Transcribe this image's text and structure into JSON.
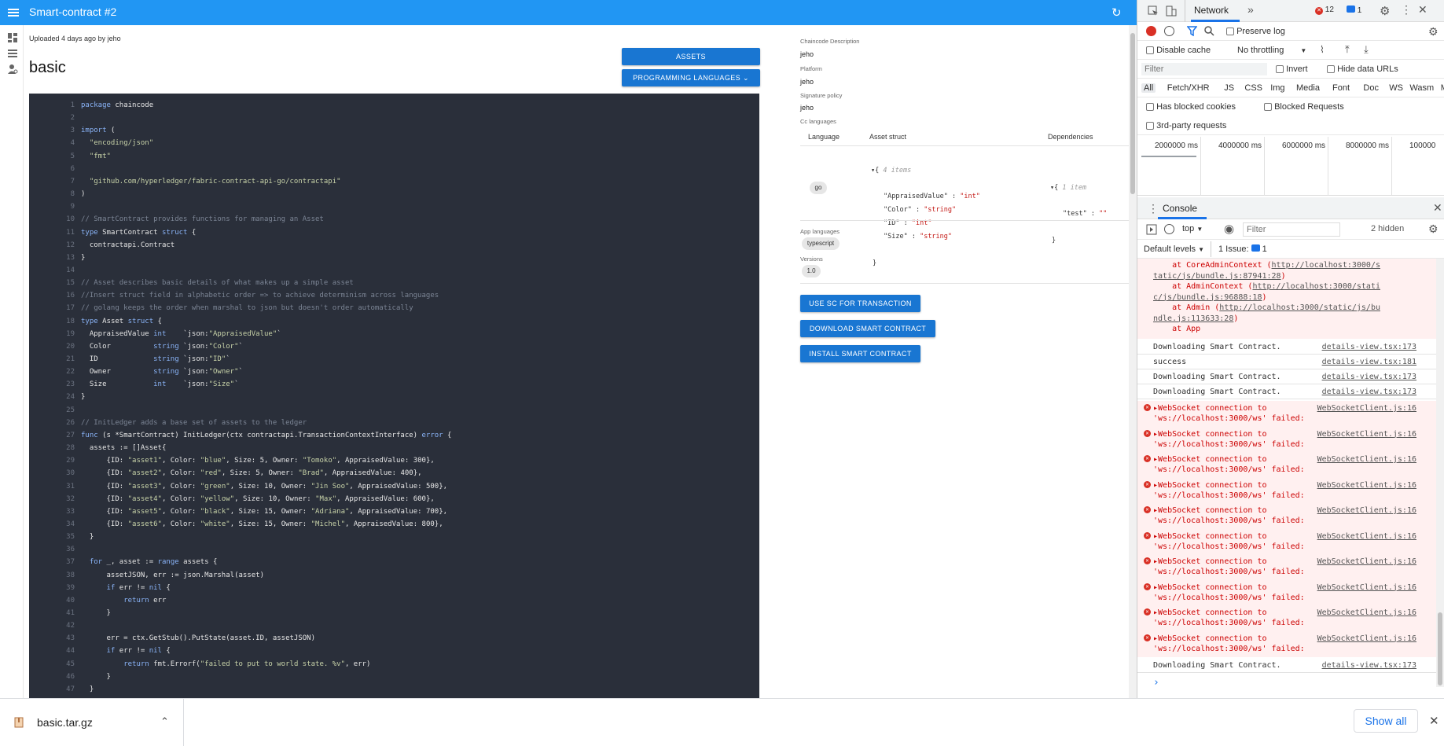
{
  "app": {
    "title": "Smart-contract #2",
    "uploaded": "Uploaded 4 days ago by jeho",
    "project_title": "basic",
    "assets_label": "ASSETS",
    "prog_lang_label": "PROGRAMMING LANGUAGES",
    "colors": {
      "appbar": "#2196f3",
      "button": "#1976d2",
      "code_bg": "#2a2f3a"
    }
  },
  "code": {
    "lines": [
      {
        "n": "1",
        "t": "package chaincode"
      },
      {
        "n": "2",
        "t": ""
      },
      {
        "n": "3",
        "t": "import ("
      },
      {
        "n": "4",
        "t": "  \"encoding/json\""
      },
      {
        "n": "5",
        "t": "  \"fmt\""
      },
      {
        "n": "6",
        "t": ""
      },
      {
        "n": "7",
        "t": "  \"github.com/hyperledger/fabric-contract-api-go/contractapi\""
      },
      {
        "n": "8",
        "t": ")"
      },
      {
        "n": "9",
        "t": ""
      },
      {
        "n": "10",
        "t": "// SmartContract provides functions for managing an Asset"
      },
      {
        "n": "11",
        "t": "type SmartContract struct {"
      },
      {
        "n": "12",
        "t": "  contractapi.Contract"
      },
      {
        "n": "13",
        "t": "}"
      },
      {
        "n": "14",
        "t": ""
      },
      {
        "n": "15",
        "t": "// Asset describes basic details of what makes up a simple asset"
      },
      {
        "n": "16",
        "t": "//Insert struct field in alphabetic order => to achieve determinism across languages"
      },
      {
        "n": "17",
        "t": "// golang keeps the order when marshal to json but doesn't order automatically"
      },
      {
        "n": "18",
        "t": "type Asset struct {"
      },
      {
        "n": "19",
        "t": "  AppraisedValue int    `json:\"AppraisedValue\"`"
      },
      {
        "n": "20",
        "t": "  Color          string `json:\"Color\"`"
      },
      {
        "n": "21",
        "t": "  ID             string `json:\"ID\"`"
      },
      {
        "n": "22",
        "t": "  Owner          string `json:\"Owner\"`"
      },
      {
        "n": "23",
        "t": "  Size           int    `json:\"Size\"`"
      },
      {
        "n": "24",
        "t": "}"
      },
      {
        "n": "25",
        "t": ""
      },
      {
        "n": "26",
        "t": "// InitLedger adds a base set of assets to the ledger"
      },
      {
        "n": "27",
        "t": "func (s *SmartContract) InitLedger(ctx contractapi.TransactionContextInterface) error {"
      },
      {
        "n": "28",
        "t": "  assets := []Asset{"
      },
      {
        "n": "29",
        "t": "      {ID: \"asset1\", Color: \"blue\", Size: 5, Owner: \"Tomoko\", AppraisedValue: 300},"
      },
      {
        "n": "30",
        "t": "      {ID: \"asset2\", Color: \"red\", Size: 5, Owner: \"Brad\", AppraisedValue: 400},"
      },
      {
        "n": "31",
        "t": "      {ID: \"asset3\", Color: \"green\", Size: 10, Owner: \"Jin Soo\", AppraisedValue: 500},"
      },
      {
        "n": "32",
        "t": "      {ID: \"asset4\", Color: \"yellow\", Size: 10, Owner: \"Max\", AppraisedValue: 600},"
      },
      {
        "n": "33",
        "t": "      {ID: \"asset5\", Color: \"black\", Size: 15, Owner: \"Adriana\", AppraisedValue: 700},"
      },
      {
        "n": "34",
        "t": "      {ID: \"asset6\", Color: \"white\", Size: 15, Owner: \"Michel\", AppraisedValue: 800},"
      },
      {
        "n": "35",
        "t": "  }"
      },
      {
        "n": "36",
        "t": ""
      },
      {
        "n": "37",
        "t": "  for _, asset := range assets {"
      },
      {
        "n": "38",
        "t": "      assetJSON, err := json.Marshal(asset)"
      },
      {
        "n": "39",
        "t": "      if err != nil {"
      },
      {
        "n": "40",
        "t": "          return err"
      },
      {
        "n": "41",
        "t": "      }"
      },
      {
        "n": "42",
        "t": ""
      },
      {
        "n": "43",
        "t": "      err = ctx.GetStub().PutState(asset.ID, assetJSON)"
      },
      {
        "n": "44",
        "t": "      if err != nil {"
      },
      {
        "n": "45",
        "t": "          return fmt.Errorf(\"failed to put to world state. %v\", err)"
      },
      {
        "n": "46",
        "t": "      }"
      },
      {
        "n": "47",
        "t": "  }"
      }
    ]
  },
  "info": {
    "cc_desc_label": "Chaincode Description",
    "cc_desc_value": "jeho",
    "platform_label": "Platform",
    "platform_value": "jeho",
    "sig_label": "Signature policy",
    "sig_value": "jeho",
    "cc_lang_label": "Cc languages",
    "th_language": "Language",
    "th_asset": "Asset struct",
    "th_deps": "Dependencies",
    "lang_chip": "go",
    "asset_count": "4 items",
    "asset_fields": [
      {
        "k": "\"AppraisedValue\"",
        "v": "\"int\""
      },
      {
        "k": "\"Color\"",
        "v": "\"string\""
      },
      {
        "k": "\"ID\"",
        "v": "\"int\""
      },
      {
        "k": "\"Size\"",
        "v": "\"string\""
      }
    ],
    "deps_count": "1 item",
    "deps_fields": [
      {
        "k": "\"test\"",
        "v": "\"\""
      }
    ],
    "app_lang_label": "App languages",
    "app_lang_chip": "typescript",
    "versions_label": "Versions",
    "version_chip": "1.0",
    "btn_use": "USE SC FOR TRANSACTION",
    "btn_download": "DOWNLOAD SMART CONTRACT",
    "btn_install": "INSTALL SMART CONTRACT"
  },
  "devtools": {
    "tab_network": "Network",
    "more": "»",
    "errors_count": "12",
    "messages_count": "1",
    "preserve_log": "Preserve log",
    "disable_cache": "Disable cache",
    "throttling": "No throttling",
    "filter_placeholder": "Filter",
    "invert": "Invert",
    "hide_data_urls": "Hide data URLs",
    "types": [
      "All",
      "Fetch/XHR",
      "JS",
      "CSS",
      "Img",
      "Media",
      "Font",
      "Doc",
      "WS",
      "Wasm",
      "M"
    ],
    "has_blocked_cookies": "Has blocked cookies",
    "blocked_requests": "Blocked Requests",
    "third_party": "3rd-party requests",
    "timeline": [
      "2000000 ms",
      "4000000 ms",
      "6000000 ms",
      "8000000 ms",
      "100000"
    ],
    "console_tab": "Console",
    "context": "top",
    "console_filter_placeholder": "Filter",
    "hidden": "2 hidden",
    "default_levels": "Default levels",
    "issues": "1 Issue:",
    "issues_count": "1",
    "stack_lines": [
      {
        "t": "    at CoreAdminContext (",
        "l": "http://localhost:3000/s",
        "c": ""
      },
      {
        "t": "",
        "l": "tatic/js/bundle.js:87941:28",
        "c": ")"
      },
      {
        "t": "    at AdminContext (",
        "l": "http://localhost:3000/stati",
        "c": ""
      },
      {
        "t": "",
        "l": "c/js/bundle.js:96888:18",
        "c": ")"
      },
      {
        "t": "    at Admin (",
        "l": "http://localhost:3000/static/js/bu",
        "c": ""
      },
      {
        "t": "",
        "l": "ndle.js:113633:28",
        "c": ")"
      },
      {
        "t": "    at App",
        "l": "",
        "c": ""
      }
    ],
    "messages": [
      {
        "msg": "Downloading Smart Contract.",
        "src": "details-view.tsx:173"
      },
      {
        "msg": "success",
        "src": "details-view.tsx:181"
      },
      {
        "msg": "Downloading Smart Contract.",
        "src": "details-view.tsx:173"
      },
      {
        "msg": "Downloading Smart Contract.",
        "src": "details-view.tsx:173"
      }
    ],
    "ws_error": {
      "line1": "WebSocket connection to ",
      "line2": "'ws://localhost:3000/ws' failed:",
      "src": "WebSocketClient.js:16"
    },
    "ws_error_count": 10,
    "last_message": {
      "msg": "Downloading Smart Contract.",
      "src": "details-view.tsx:173"
    }
  },
  "downloads": {
    "file": "basic.tar.gz",
    "show_all": "Show all"
  }
}
